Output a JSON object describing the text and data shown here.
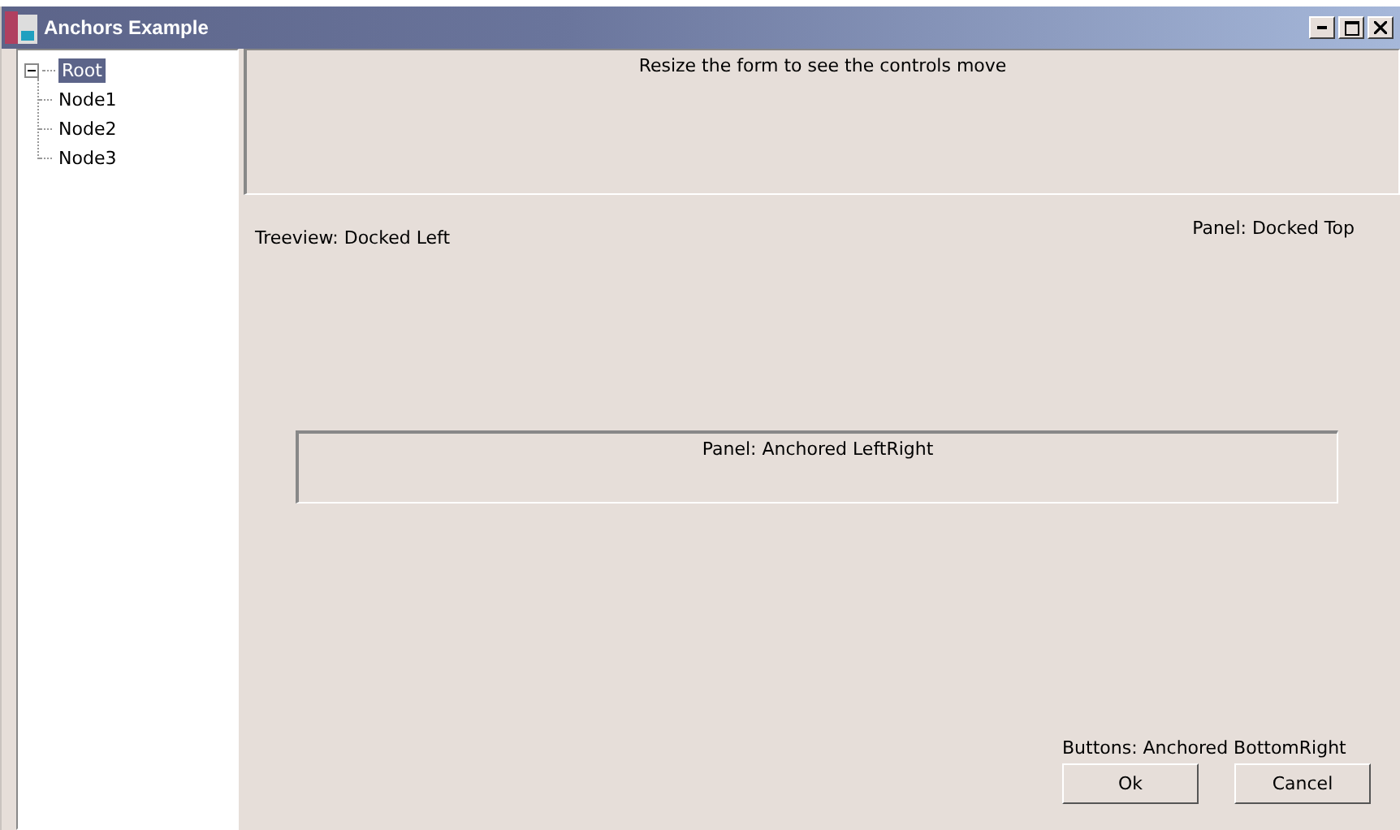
{
  "window": {
    "title": "Anchors Example"
  },
  "tree": {
    "items": [
      {
        "label": "Root",
        "selected": true,
        "expanded": true,
        "children": [
          {
            "label": "Node1",
            "selected": false
          },
          {
            "label": "Node2",
            "selected": false
          },
          {
            "label": "Node3",
            "selected": false
          }
        ]
      }
    ]
  },
  "top_panel": {
    "text": "Resize the form to see the controls move"
  },
  "labels": {
    "panel_docked_top": "Panel: Docked Top",
    "treeview": "Treeview: Docked Left"
  },
  "anchored_panel": {
    "text": "Panel: Anchored LeftRight"
  },
  "buttons_label": "Buttons: Anchored BottomRight",
  "buttons": [
    "Ok",
    "Cancel"
  ]
}
